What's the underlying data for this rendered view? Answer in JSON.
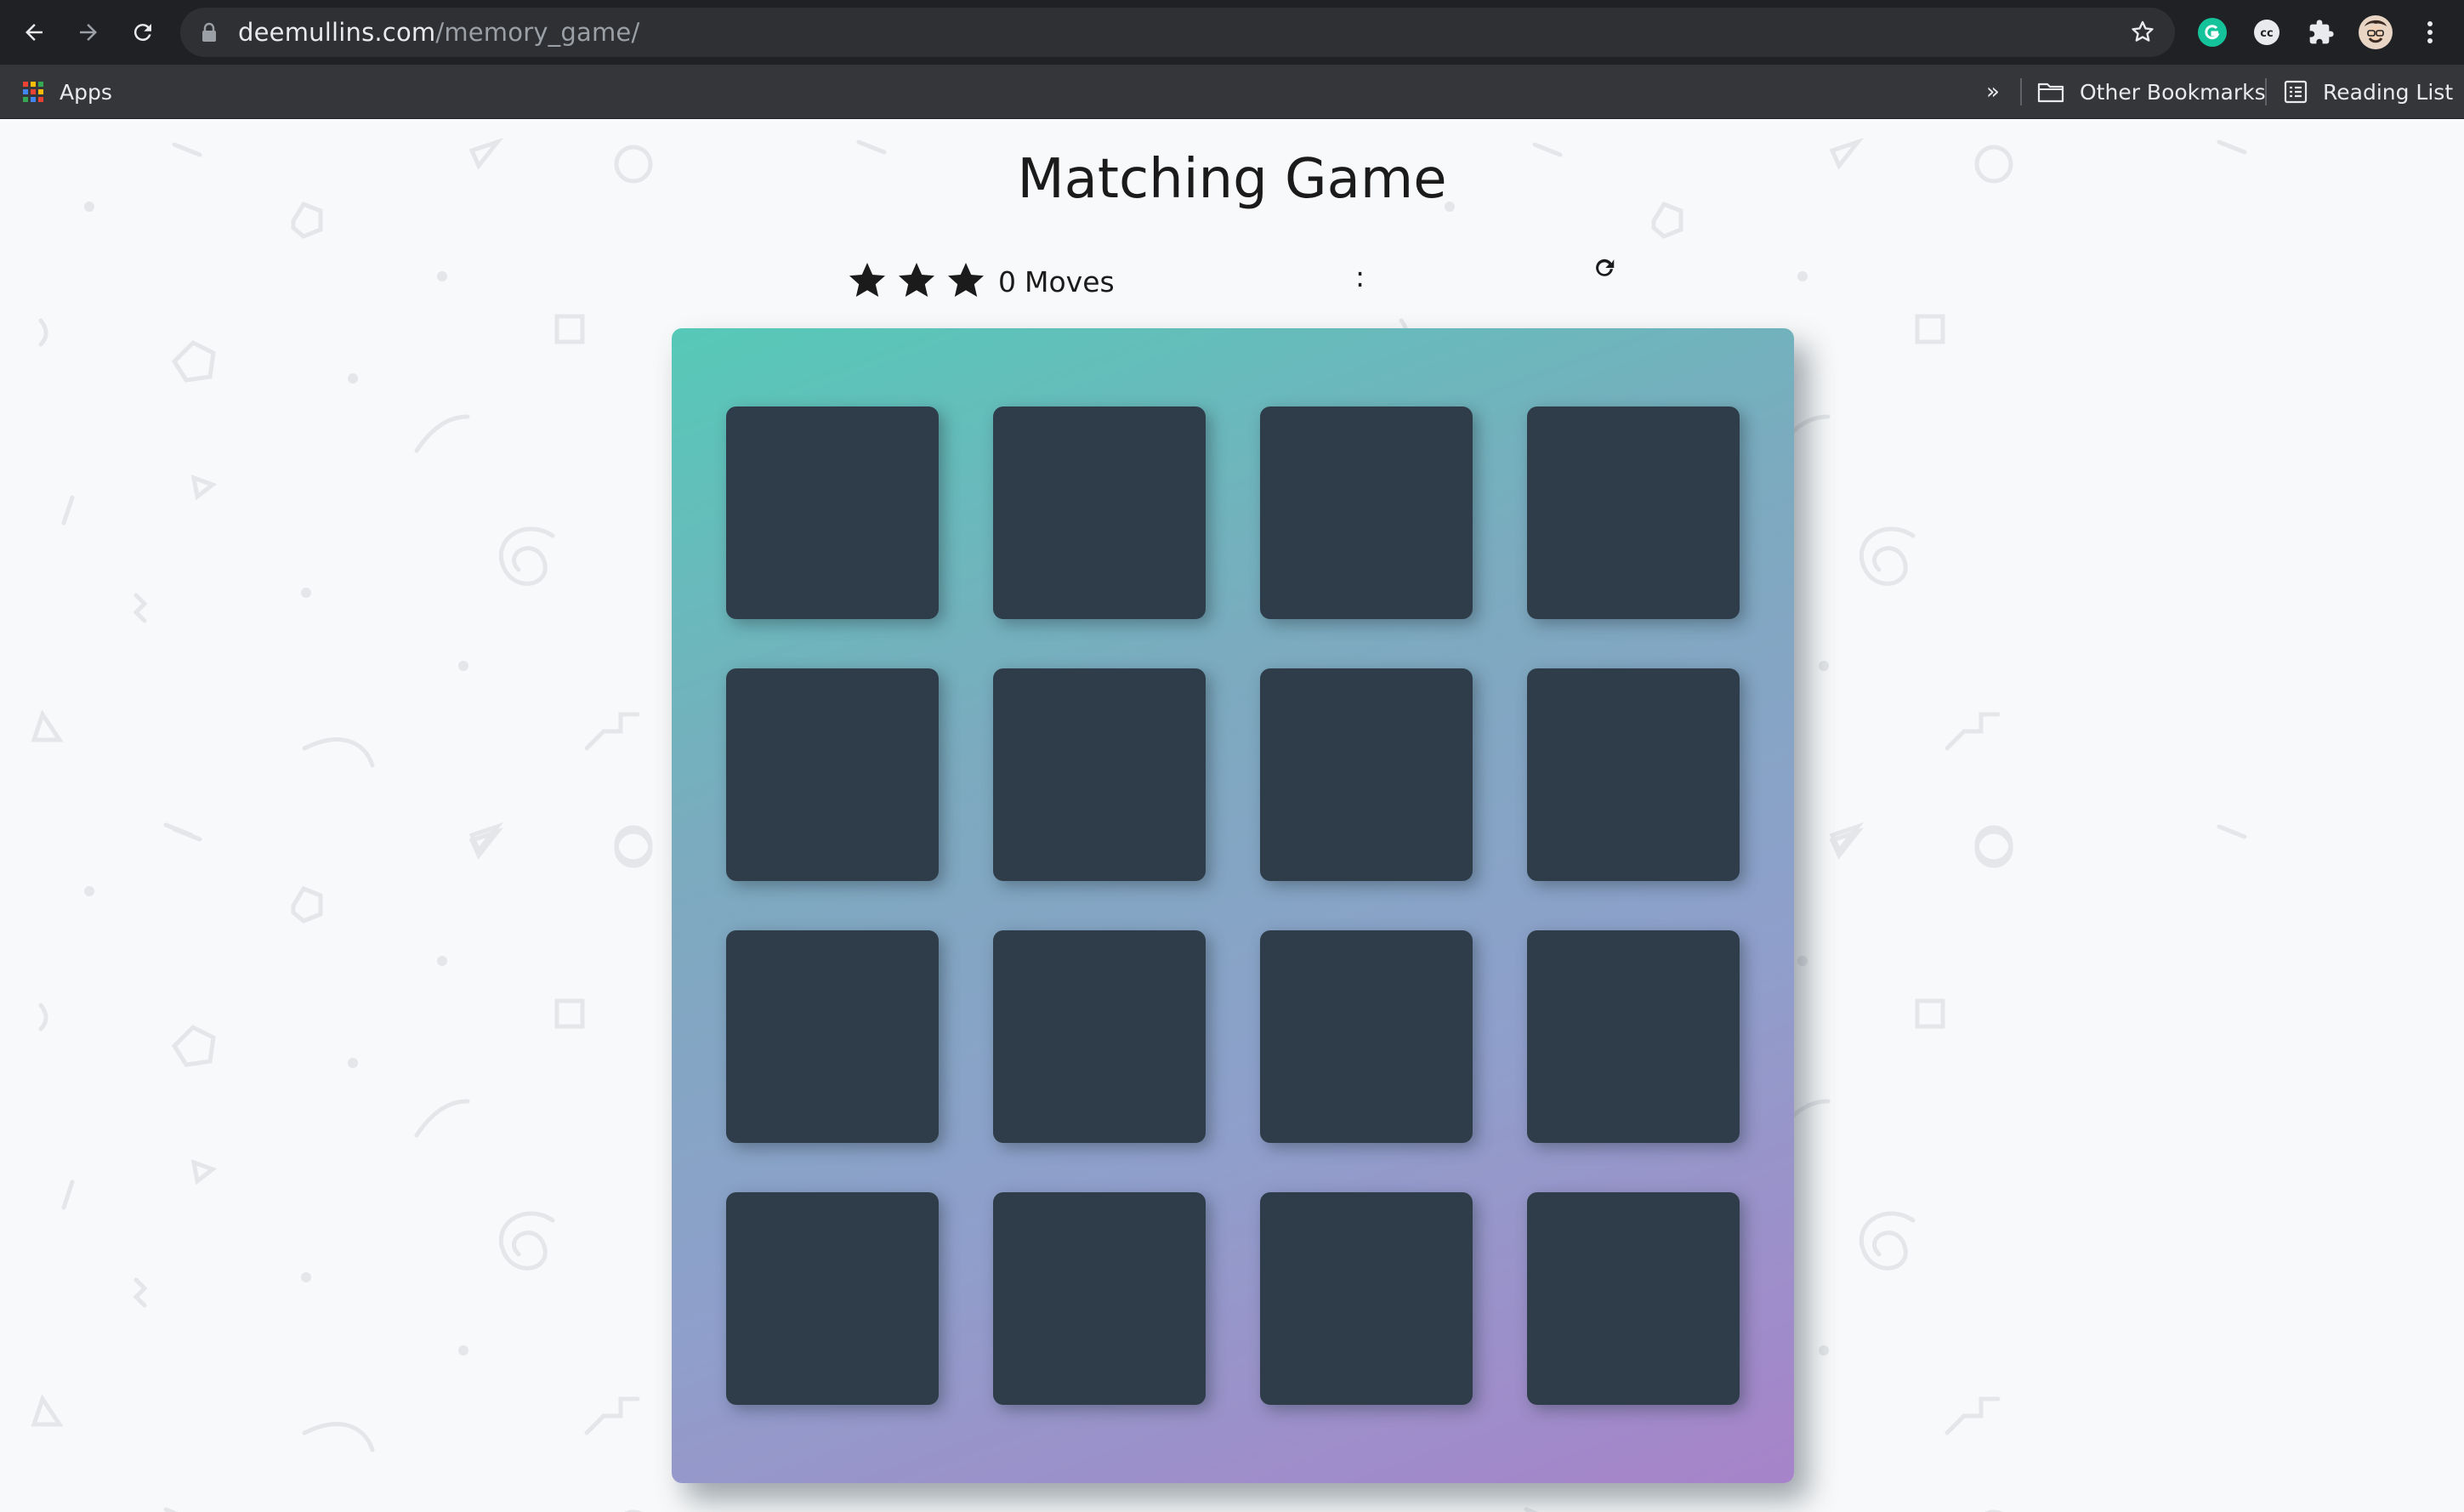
{
  "browser": {
    "url_host": "deemullins.com",
    "url_path": "/memory_game/",
    "bookmarks": {
      "apps_label": "Apps",
      "overflow_label": "»",
      "other_bookmarks_label": "Other Bookmarks",
      "reading_list_label": "Reading List"
    },
    "extension_icons": [
      "grammarly-icon",
      "cc-icon",
      "extensions-puzzle-icon",
      "profile-avatar",
      "menu-kebab-icon"
    ]
  },
  "game": {
    "title": "Matching Game",
    "star_rating": 3,
    "moves_count": "0",
    "moves_label": "Moves",
    "timer_text": ":",
    "restart_icon": "restart-icon",
    "card_color": "#2e3d49",
    "deck_gradient": [
      "#56c9b8",
      "#a783c9"
    ],
    "cards": [
      {
        "state": "face-down"
      },
      {
        "state": "face-down"
      },
      {
        "state": "face-down"
      },
      {
        "state": "face-down"
      },
      {
        "state": "face-down"
      },
      {
        "state": "face-down"
      },
      {
        "state": "face-down"
      },
      {
        "state": "face-down"
      },
      {
        "state": "face-down"
      },
      {
        "state": "face-down"
      },
      {
        "state": "face-down"
      },
      {
        "state": "face-down"
      },
      {
        "state": "face-down"
      },
      {
        "state": "face-down"
      },
      {
        "state": "face-down"
      },
      {
        "state": "face-down"
      }
    ]
  }
}
